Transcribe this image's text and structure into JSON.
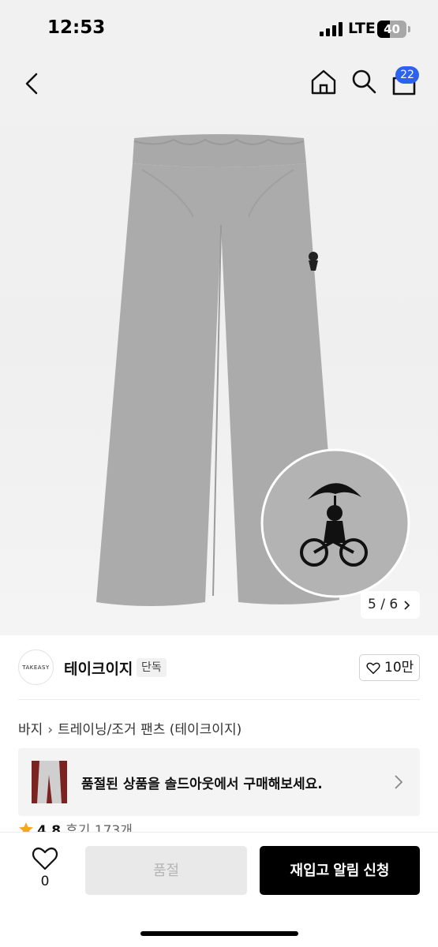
{
  "status_bar": {
    "time": "12:53",
    "network": "LTE",
    "battery": "40"
  },
  "header": {
    "cart_count": "22"
  },
  "gallery": {
    "counter": "5 / 6"
  },
  "brand": {
    "logo_text": "TAKEASY",
    "name": "테이크이지",
    "tag": "단독",
    "likes": "10만"
  },
  "breadcrumb": {
    "items": [
      "바지",
      "트레이닝/조거 팬츠 (테이크이지)"
    ]
  },
  "soldout_banner": {
    "text": "품절된 상품을 솔드아웃에서 구매해보세요."
  },
  "rating": {
    "score": "4.8",
    "reviews": "후기 173개"
  },
  "bottom_bar": {
    "wish_count": "0",
    "soldout_label": "품절",
    "restock_label": "재입고 알림 신청"
  },
  "colors": {
    "accent_badge": "#2b63f0",
    "cta": "#000000",
    "disabled": "#e9e9e9",
    "star": "#f5a623"
  },
  "icons": [
    "back-icon",
    "home-icon",
    "search-icon",
    "cart-icon",
    "chevron-right-icon",
    "heart-icon",
    "star-icon"
  ]
}
